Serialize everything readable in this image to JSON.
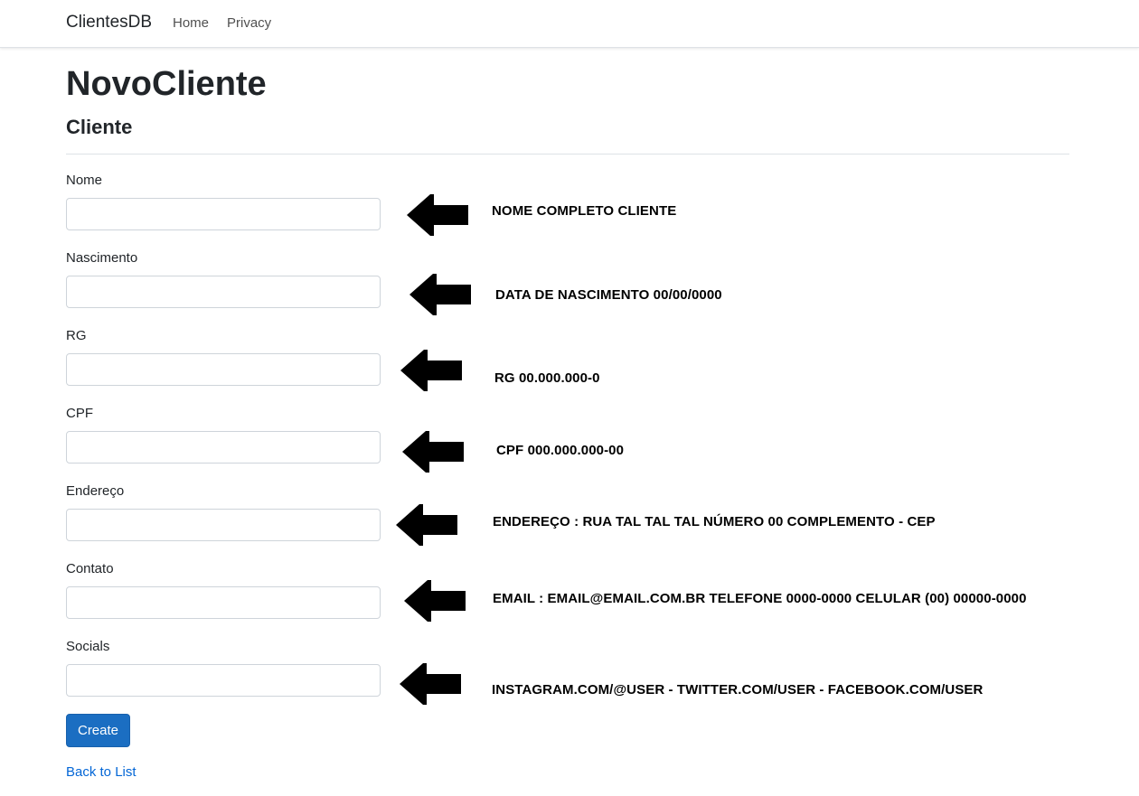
{
  "navbar": {
    "brand": "ClientesDB",
    "links": [
      "Home",
      "Privacy"
    ]
  },
  "page": {
    "title": "NovoCliente",
    "subtitle": "Cliente"
  },
  "form": {
    "fields": [
      {
        "label": "Nome",
        "value": "",
        "annotation": "NOME COMPLETO CLIENTE"
      },
      {
        "label": "Nascimento",
        "value": "",
        "annotation": "DATA DE NASCIMENTO 00/00/0000"
      },
      {
        "label": "RG",
        "value": "",
        "annotation": "RG  00.000.000-0"
      },
      {
        "label": "CPF",
        "value": "",
        "annotation": "CPF 000.000.000-00"
      },
      {
        "label": "Endereço",
        "value": "",
        "annotation": "ENDEREÇO : RUA TAL TAL TAL NÚMERO 00 COMPLEMENTO - CEP"
      },
      {
        "label": "Contato",
        "value": "",
        "annotation": "EMAIL : EMAIL@EMAIL.COM.BR TELEFONE 0000-0000 CELULAR (00) 00000-0000"
      },
      {
        "label": "Socials",
        "value": "",
        "annotation": "INSTAGRAM.COM/@USER - TWITTER.COM/USER - FACEBOOK.COM/USER"
      }
    ],
    "submit_label": "Create",
    "back_link": "Back to List"
  },
  "icons": {
    "arrow": "arrow-left-icon"
  },
  "colors": {
    "primary_button": "#1b6ec2",
    "link": "#0366d6",
    "annotation_text": "#000000"
  }
}
